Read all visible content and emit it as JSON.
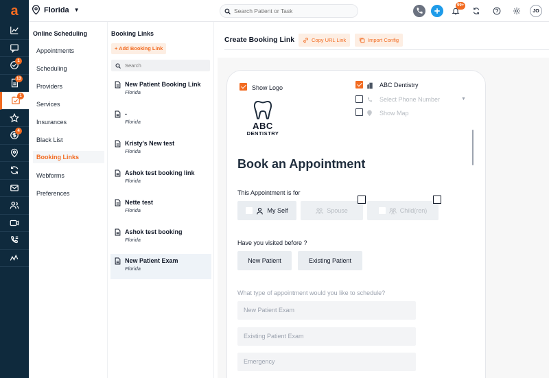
{
  "topbar": {
    "location": "Florida",
    "search_placeholder": "Search Patient or Task",
    "notification_count": "99+",
    "avatar_initials": "JO"
  },
  "rail": {
    "logo": "a",
    "items": [
      {
        "icon": "analytics-icon",
        "badge": ""
      },
      {
        "icon": "chat-icon",
        "badge": ""
      },
      {
        "icon": "tasks-check-icon",
        "badge": "1"
      },
      {
        "icon": "document-icon",
        "badge": "13"
      },
      {
        "icon": "scheduling-icon",
        "badge": "1",
        "active": true
      },
      {
        "icon": "star-icon",
        "badge": ""
      },
      {
        "icon": "payments-icon",
        "badge": "4"
      },
      {
        "icon": "location-icon",
        "badge": ""
      },
      {
        "icon": "sync-icon",
        "badge": ""
      },
      {
        "icon": "mail-icon",
        "badge": ""
      },
      {
        "icon": "users-icon",
        "badge": ""
      },
      {
        "icon": "video-icon",
        "badge": ""
      },
      {
        "icon": "phone-list-icon",
        "badge": ""
      },
      {
        "icon": "activity-icon",
        "badge": ""
      }
    ]
  },
  "menu": {
    "title": "Online Scheduling",
    "items": [
      "Appointments",
      "Scheduling",
      "Providers",
      "Services",
      "Insurances",
      "Black List",
      "Booking Links",
      "Webforms",
      "Preferences"
    ],
    "active_index": 6
  },
  "booking_links": {
    "title": "Booking Links",
    "add_label": "+ Add Booking Link",
    "search_placeholder": "Search",
    "items": [
      {
        "name": "New Patient Booking Link",
        "location": "Florida"
      },
      {
        "name": "-",
        "location": "Florida"
      },
      {
        "name": "Kristy's New test",
        "location": "Florida"
      },
      {
        "name": "Ashok test booking link",
        "location": "Florida"
      },
      {
        "name": "Nette test",
        "location": "Florida"
      },
      {
        "name": "Ashok test booking",
        "location": "Florida"
      },
      {
        "name": "New Patient Exam",
        "location": "Florida"
      }
    ],
    "selected_index": 6
  },
  "main": {
    "title": "Create Booking Link",
    "copy_url_label": "Copy URL Link",
    "import_config_label": "Import Config",
    "preview": {
      "show_logo_label": "Show Logo",
      "show_logo_checked": true,
      "practice_name": "ABC Dentistry",
      "practice_name_checked": true,
      "phone_placeholder": "Select Phone Number",
      "show_map_label": "Show Map",
      "logo_main": "ABC",
      "logo_sub": "DENTISTRY",
      "heading": "Book an Appointment",
      "for_label": "This Appointment is for",
      "for_options": [
        "My Self",
        "Spouse",
        "Child(ren)"
      ],
      "visited_label": "Have you visited before ?",
      "visited_options": [
        "New Patient",
        "Existing Patient"
      ],
      "type_label": "What type of appointment would you like to schedule?",
      "type_options": [
        "New Patient Exam",
        "Existing Patient Exam",
        "Emergency"
      ]
    }
  },
  "colors": {
    "accent": "#f26b21",
    "rail_bg": "#0f2a3d",
    "primary_blue": "#1e9be9"
  }
}
